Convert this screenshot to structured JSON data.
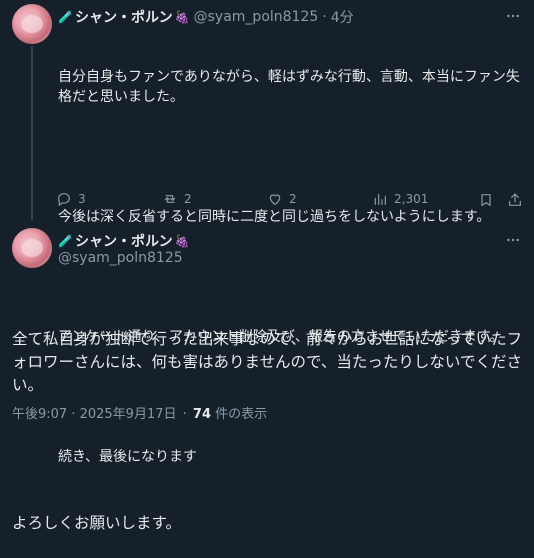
{
  "reply_tweet": {
    "display_name": "シャン・ポルン",
    "handle": "@syam_poln8125",
    "separator": "·",
    "time_ago": "4分",
    "paragraphs": [
      "自分自身もファンでありながら、軽はずみな行動、言動、本当にファン失格だと思いました。",
      "今後は深く反省すると同時に二度と同じ過ちをしないようにします。",
      "アンケート通り、アカウント削除及び、報告の方させていただきます。",
      "続き、最後になります"
    ],
    "replies_count": "3",
    "retweets_count": "2",
    "likes_count": "2",
    "views_count": "2,301",
    "icons": [
      "reply-icon",
      "retweet-icon",
      "like-icon",
      "views-icon",
      "bookmark-icon",
      "share-icon",
      "more-icon"
    ]
  },
  "main_tweet": {
    "display_name": "シャン・ポルン",
    "handle": "@syam_poln8125",
    "paragraphs": [
      "全て私自身が独断で行った出来事なので、前々からお世話になっていたフォロワーさんには、何も害はありませんので、当たったりしないでください。",
      "よろしくお願いします。"
    ],
    "timestamp": "午後9:07 · 2025年9月17日",
    "meta_separator": "·",
    "views_count": "74",
    "views_label": "件の表示"
  },
  "colors": {
    "background": "#15202b",
    "text": "#e7e9ea",
    "muted": "#8b98a5",
    "thread_line": "#38444d"
  }
}
